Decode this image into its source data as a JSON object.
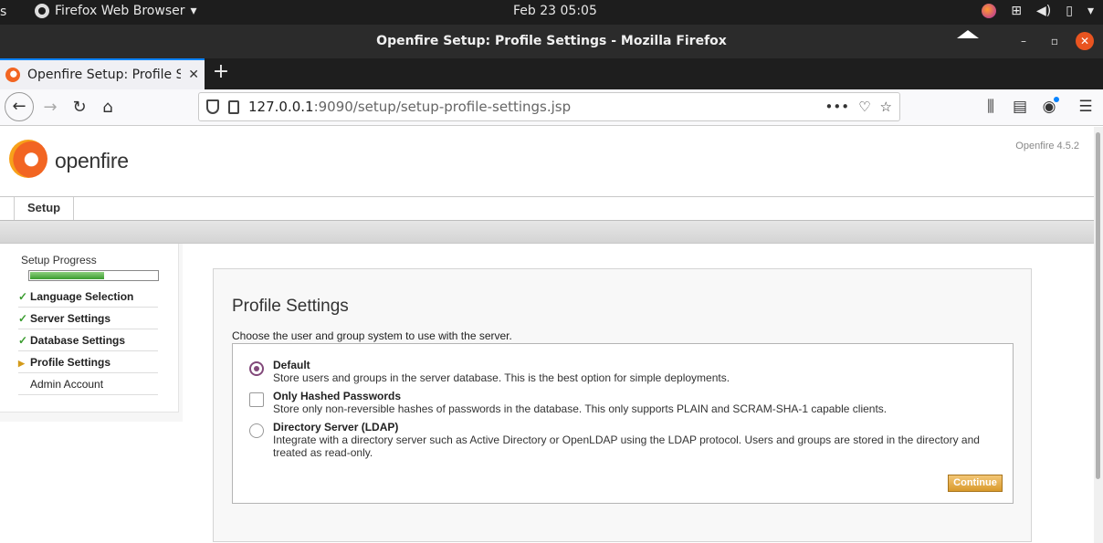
{
  "topbar": {
    "activities": "s",
    "app_menu": "Firefox Web Browser",
    "clock": "Feb 23  05:05"
  },
  "window": {
    "title": "Openfire Setup: Profile Settings - Mozilla Firefox"
  },
  "tab": {
    "title": "Openfire Setup: Profile S"
  },
  "urlbar": {
    "host": "127.0.0.1",
    "rest": ":9090/setup/setup-profile-settings.jsp"
  },
  "page": {
    "logo_text": "openfire",
    "version": "Openfire 4.5.2",
    "main_tab": "Setup",
    "sidebar": {
      "progress_label": "Setup Progress",
      "progress": 0.58,
      "steps": [
        {
          "label": "Language Selection",
          "state": "done"
        },
        {
          "label": "Server Settings",
          "state": "done"
        },
        {
          "label": "Database Settings",
          "state": "done"
        },
        {
          "label": "Profile Settings",
          "state": "current"
        },
        {
          "label": "Admin Account",
          "state": "pending"
        }
      ]
    },
    "heading": "Profile Settings",
    "intro": "Choose the user and group system to use with the server.",
    "options": [
      {
        "title": "Default",
        "desc": "Store users and groups in the server database. This is the best option for simple deployments.",
        "control": "radio",
        "selected": true
      },
      {
        "title": "Only Hashed Passwords",
        "desc": "Store only non-reversible hashes of passwords in the database. This only supports PLAIN and SCRAM-SHA-1 capable clients.",
        "control": "checkbox",
        "selected": false
      },
      {
        "title": "Directory Server (LDAP)",
        "desc": "Integrate with a directory server such as Active Directory or OpenLDAP using the LDAP protocol. Users and groups are stored in the directory and treated as read-only.",
        "control": "radio",
        "selected": false
      }
    ],
    "continue_label": "Continue"
  },
  "colors": {
    "accent_radio": "#82497a",
    "continue_button": "#d99a2c",
    "progress_fill": "#3a9c2f",
    "tab_highlight": "#0a84ff",
    "close_button": "#e95420"
  }
}
